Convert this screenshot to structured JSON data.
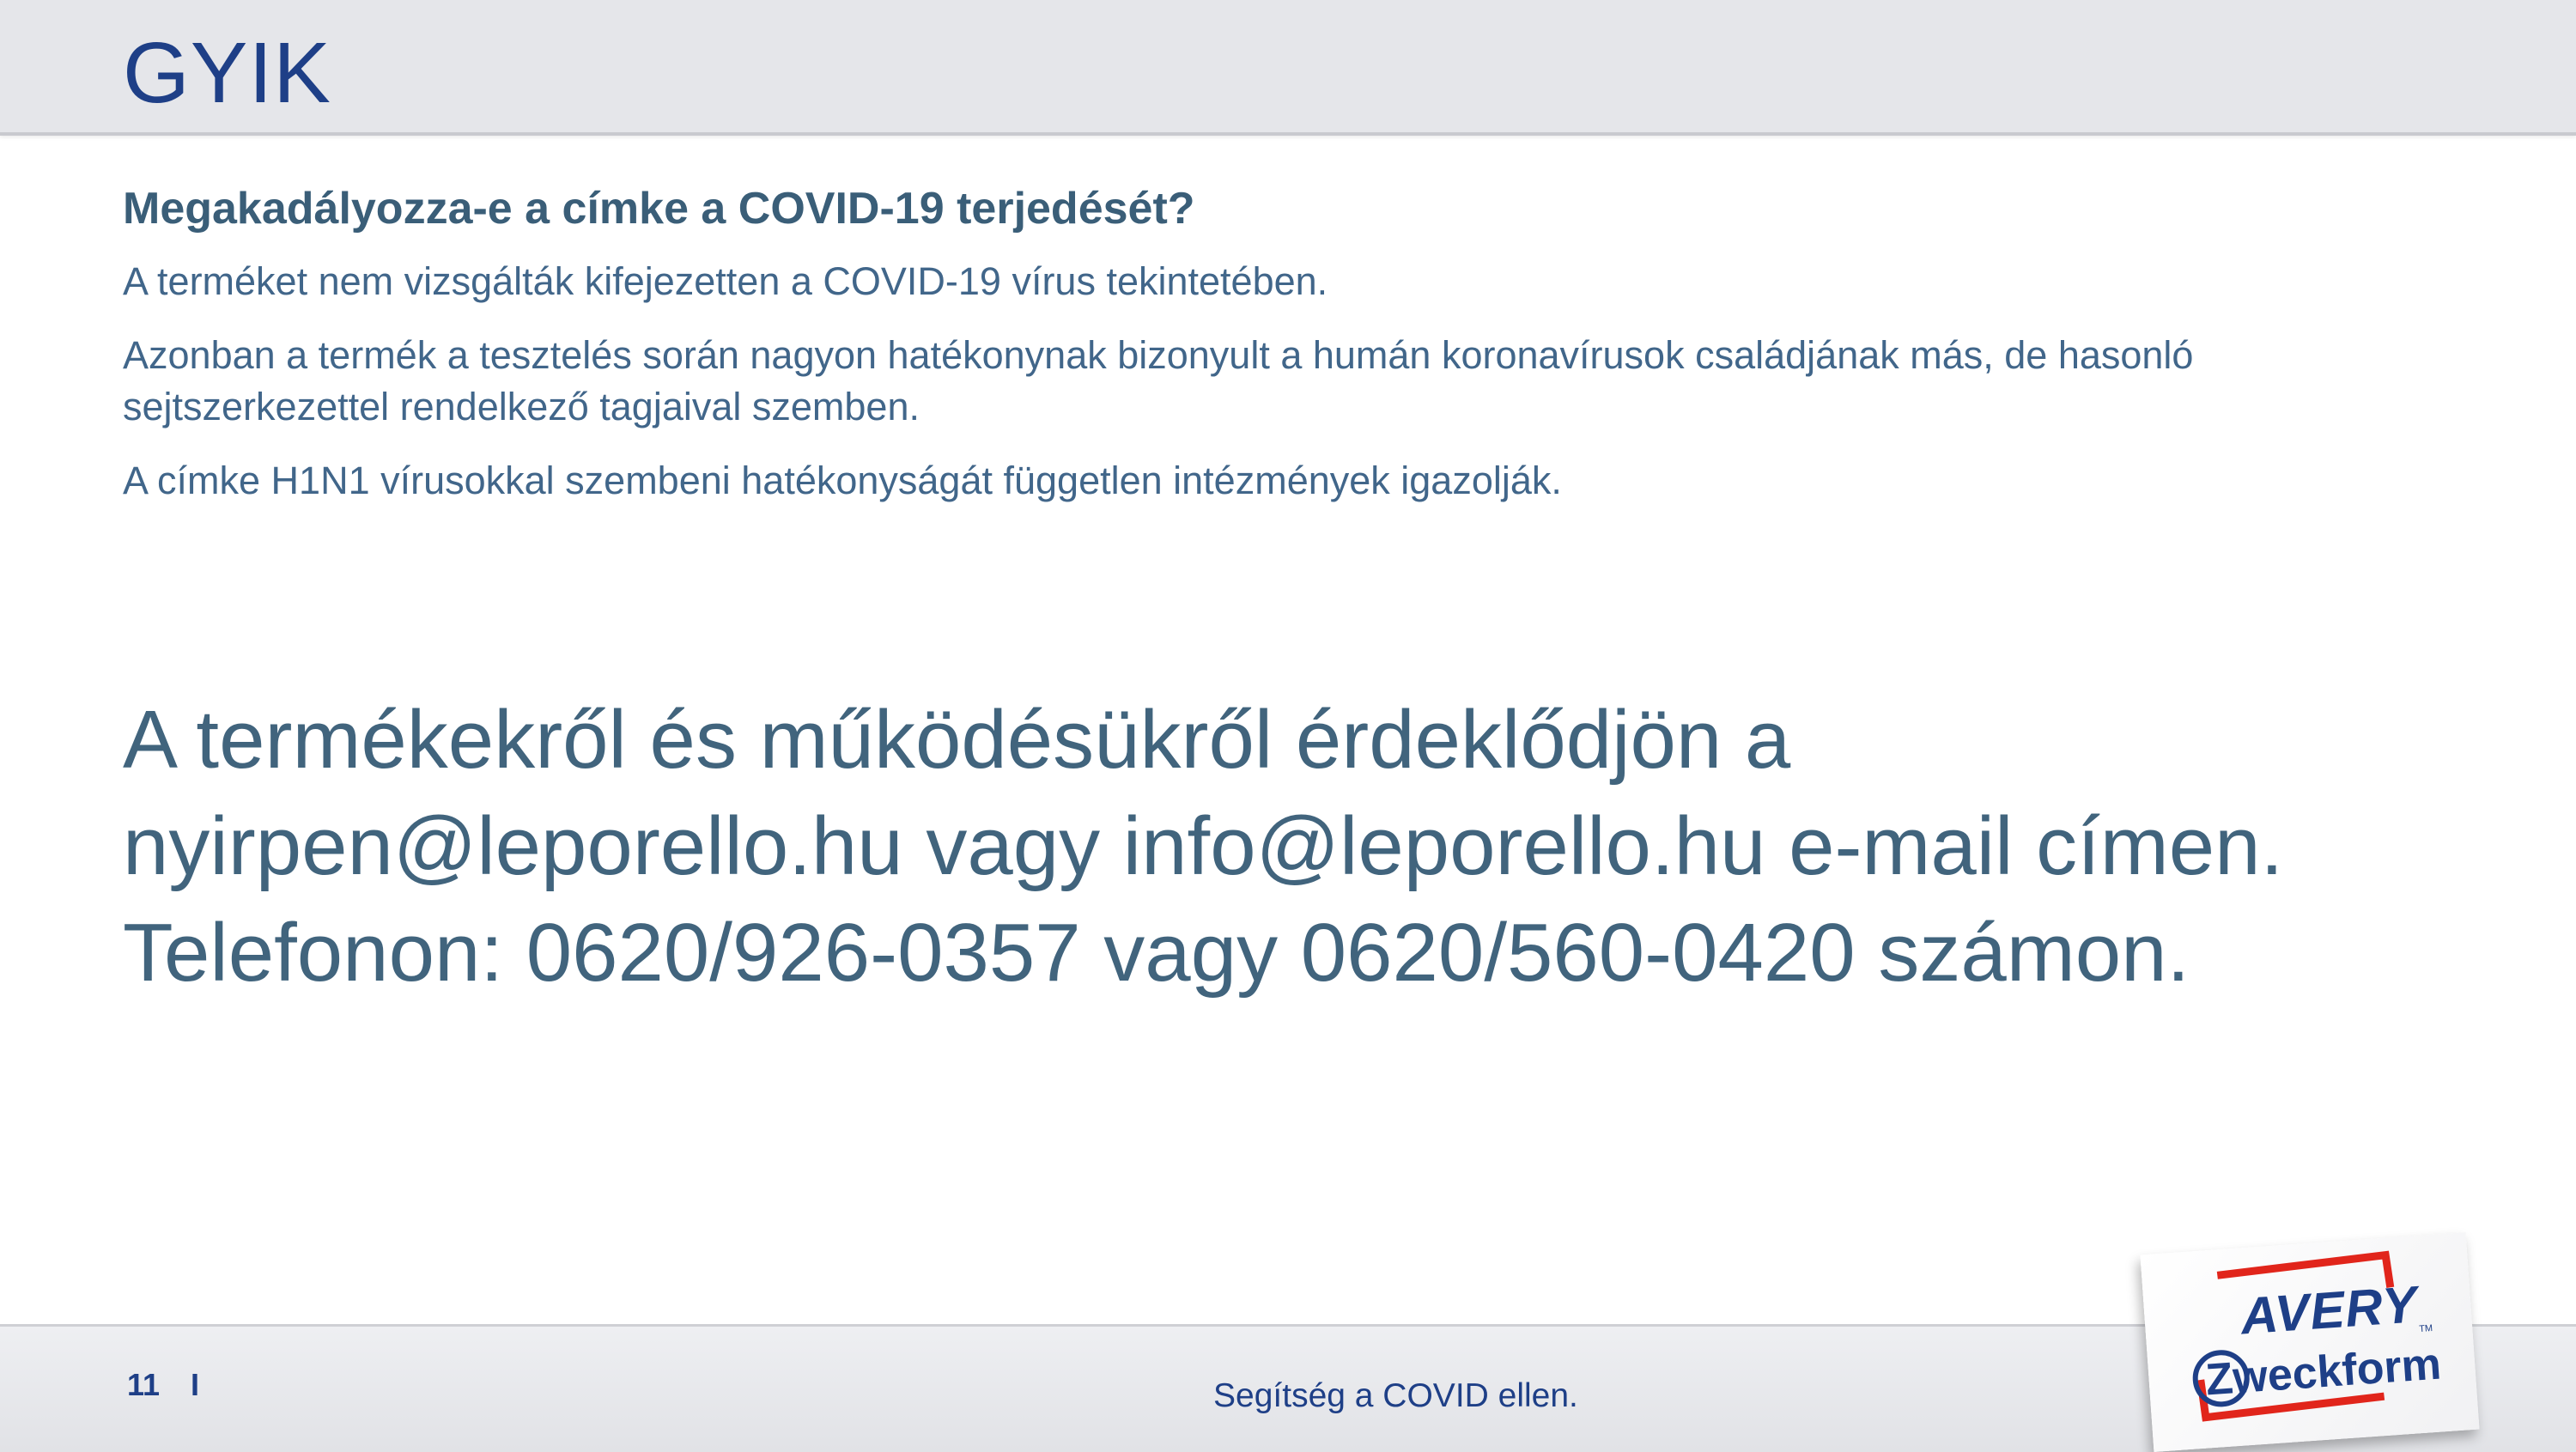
{
  "header": {
    "title": "GYIK"
  },
  "faq": {
    "question": "Megakadályozza-e a címke a COVID-19 terjedését?",
    "paragraphs": [
      "A terméket nem vizsgálták kifejezetten a COVID-19 vírus tekintetében.",
      "Azonban a termék a tesztelés során nagyon hatékonynak bizonyult a humán koronavírusok családjának más, de hasonló sejtszerkezettel rendelkező tagjaival szemben.",
      "A címke H1N1 vírusokkal szembeni hatékonyságát független intézmények igazolják."
    ]
  },
  "contact": {
    "lines": [
      "A termékekről és működésükről érdeklődjön a",
      "nyirpen@leporello.hu vagy info@leporello.hu e-mail címen.",
      "Telefonon: 0620/926-0357 vagy 0620/560-0420 számon."
    ]
  },
  "footer": {
    "page_number": "11",
    "separator": "I",
    "slogan": "Segítség a COVID ellen."
  },
  "logo": {
    "line1": "AVERY",
    "line2": "Zweckform",
    "trademark": "TM",
    "brand_red": "#e1251b",
    "brand_blue": "#1e3f87"
  }
}
